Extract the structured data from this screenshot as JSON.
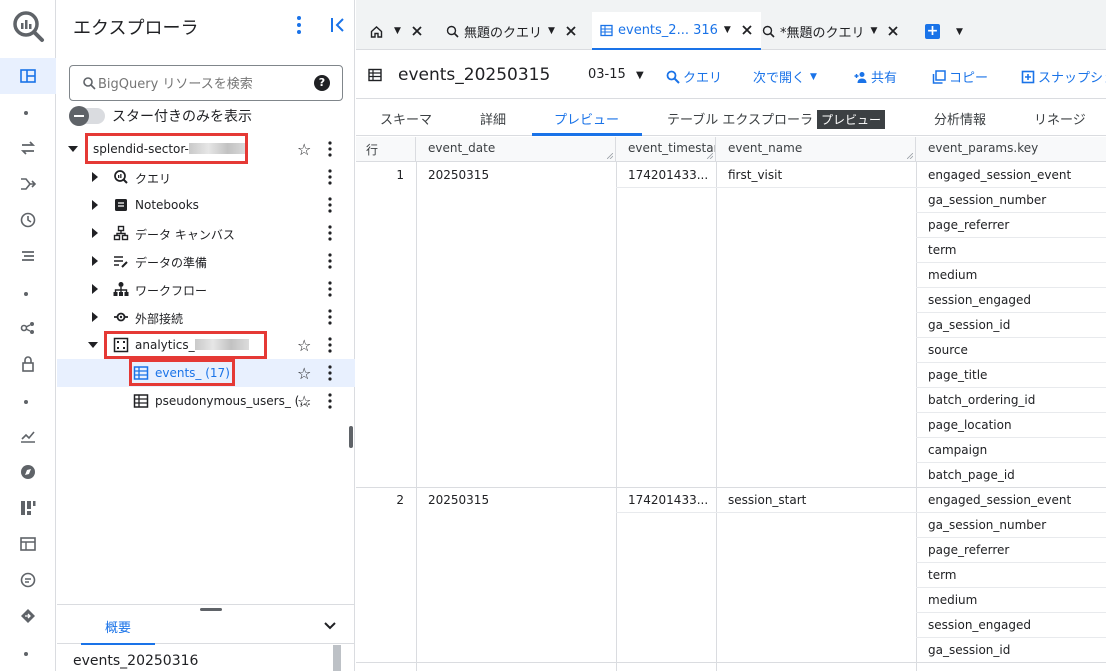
{
  "explorer": {
    "title": "エクスプローラ",
    "search_placeholder": "BigQuery リソースを検索",
    "help_glyph": "?",
    "star_filter_label": "スター付きのみを表示",
    "project": "splendid-sector-",
    "nodes": [
      {
        "label": "クエリ",
        "icon": "query-icon"
      },
      {
        "label": "Notebooks",
        "icon": "notebook-icon"
      },
      {
        "label": "データ キャンバス",
        "icon": "canvas-icon"
      },
      {
        "label": "データの準備",
        "icon": "data-prep-icon"
      },
      {
        "label": "ワークフロー",
        "icon": "workflow-icon"
      },
      {
        "label": "外部接続",
        "icon": "external-connection-icon"
      }
    ],
    "dataset": "analytics_",
    "tables": [
      {
        "label": "events_ (17)",
        "selected": true
      },
      {
        "label": "pseudonymous_users_ (..."
      }
    ],
    "bottom_tab": "概要",
    "bottom_table": "events_20250316"
  },
  "tabs": [
    {
      "label": "",
      "icon": "home-icon"
    },
    {
      "label": "無題のクエリ",
      "icon": "query-icon"
    },
    {
      "label": "events_2... 316",
      "icon": "table-icon",
      "active": true
    },
    {
      "label": "*無題のクエリ",
      "icon": "query-icon"
    }
  ],
  "toolbar": {
    "title": "events_20250315",
    "date": "03-15",
    "query": "クエリ",
    "open_next": "次で開く",
    "share": "共有",
    "copy": "コピー",
    "snapshot": "スナップショ"
  },
  "subtabs": {
    "schema": "スキーマ",
    "details": "詳細",
    "preview": "プレビュー",
    "table_explorer": "テーブル エクスプローラ",
    "table_explorer_badge": "プレビュー",
    "insights": "分析情報",
    "lineage": "リネージ"
  },
  "grid": {
    "headers": [
      "行",
      "event_date",
      "event_timestamp",
      "event_name",
      "event_params.key"
    ],
    "rows": [
      {
        "row": "1",
        "event_date": "20250315",
        "event_timestamp": "174201433...",
        "event_name": "first_visit",
        "keys": [
          "engaged_session_event",
          "ga_session_number",
          "page_referrer",
          "term",
          "medium",
          "session_engaged",
          "ga_session_id",
          "source",
          "page_title",
          "batch_ordering_id",
          "page_location",
          "campaign",
          "batch_page_id"
        ]
      },
      {
        "row": "2",
        "event_date": "20250315",
        "event_timestamp": "174201433...",
        "event_name": "session_start",
        "keys": [
          "engaged_session_event",
          "ga_session_number",
          "page_referrer",
          "term",
          "medium",
          "session_engaged",
          "ga_session_id"
        ]
      }
    ]
  },
  "colors": {
    "accent": "#1a73e8",
    "highlight_box": "#e53935",
    "selected_row": "#e8f0fe"
  }
}
